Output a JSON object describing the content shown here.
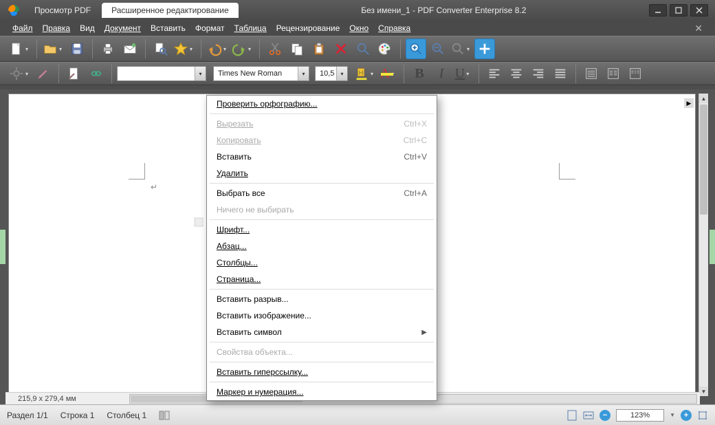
{
  "title": "Без имени_1 - PDF Converter Enterprise 8.2",
  "tabs": {
    "view": "Просмотр PDF",
    "edit": "Расширенное редактирование"
  },
  "menu": {
    "file": "Файл",
    "edit": "Правка",
    "view": "Вид",
    "document": "Документ",
    "insert": "Вставить",
    "format": "Формат",
    "table": "Таблица",
    "review": "Рецензирование",
    "window": "Окно",
    "help": "Справка"
  },
  "toolbar2": {
    "style_value": "",
    "font_value": "Times New Roman",
    "size_value": "10,5"
  },
  "context": {
    "spellcheck": "Проверить орфографию...",
    "cut": "Вырезать",
    "cut_sc": "Ctrl+X",
    "copy": "Копировать",
    "copy_sc": "Ctrl+C",
    "paste": "Вставить",
    "paste_sc": "Ctrl+V",
    "delete": "Удалить",
    "select_all": "Выбрать все",
    "select_all_sc": "Ctrl+A",
    "select_none": "Ничего не выбирать",
    "font": "Шрифт...",
    "paragraph": "Абзац...",
    "columns": "Столбцы...",
    "page": "Страница...",
    "insert_break": "Вставить разрыв...",
    "insert_image": "Вставить изображение...",
    "insert_symbol": "Вставить символ",
    "object_props": "Свойства объекта...",
    "insert_link": "Вставить гиперссылку...",
    "bullets": "Маркер и нумерация..."
  },
  "status": {
    "dims": "215,9 x 279,4 мм",
    "section": "Раздел 1/1",
    "line": "Строка 1",
    "column": "Столбец 1",
    "zoom": "123%"
  }
}
